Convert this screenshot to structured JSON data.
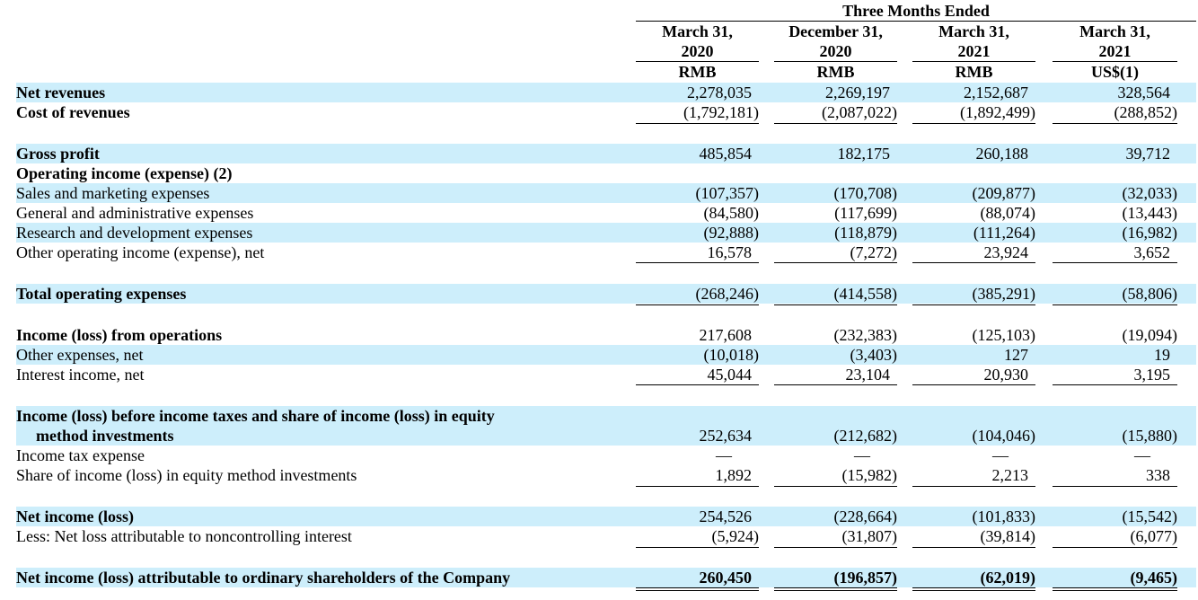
{
  "header": {
    "period_title": "Three Months Ended",
    "columns": [
      {
        "line1": "March 31,",
        "line2": "2020",
        "currency": "RMB"
      },
      {
        "line1": "December 31,",
        "line2": "2020",
        "currency": "RMB"
      },
      {
        "line1": "March 31,",
        "line2": "2021",
        "currency": "RMB"
      },
      {
        "line1": "March 31,",
        "line2": "2021",
        "currency": "US$(1)"
      }
    ]
  },
  "rows": [
    {
      "label": "Net revenues",
      "values": [
        "2,278,035",
        "2,269,197",
        "2,152,687",
        "328,564"
      ]
    },
    {
      "label": "Cost of revenues",
      "values": [
        "(1,792,181)",
        "(2,087,022)",
        "(1,892,499)",
        "(288,852)"
      ]
    },
    {
      "label": "Gross profit",
      "values": [
        "485,854",
        "182,175",
        "260,188",
        "39,712"
      ]
    },
    {
      "label": "Operating income (expense) (2)",
      "values": [
        "",
        "",
        "",
        ""
      ]
    },
    {
      "label": "Sales and marketing expenses",
      "values": [
        "(107,357)",
        "(170,708)",
        "(209,877)",
        "(32,033)"
      ]
    },
    {
      "label": "General and administrative expenses",
      "values": [
        "(84,580)",
        "(117,699)",
        "(88,074)",
        "(13,443)"
      ]
    },
    {
      "label": "Research and development expenses",
      "values": [
        "(92,888)",
        "(118,879)",
        "(111,264)",
        "(16,982)"
      ]
    },
    {
      "label": "Other operating income (expense), net",
      "values": [
        "16,578",
        "(7,272)",
        "23,924",
        "3,652"
      ]
    },
    {
      "label": "Total operating expenses",
      "values": [
        "(268,246)",
        "(414,558)",
        "(385,291)",
        "(58,806)"
      ]
    },
    {
      "label": "Income (loss) from operations",
      "values": [
        "217,608",
        "(232,383)",
        "(125,103)",
        "(19,094)"
      ]
    },
    {
      "label": "Other expenses, net",
      "values": [
        "(10,018)",
        "(3,403)",
        "127",
        "19"
      ]
    },
    {
      "label": "Interest income, net",
      "values": [
        "45,044",
        "23,104",
        "20,930",
        "3,195"
      ]
    },
    {
      "label": "Income (loss) before income taxes and share of income (loss) in equity",
      "label2": "method investments",
      "values": [
        "252,634",
        "(212,682)",
        "(104,046)",
        "(15,880)"
      ]
    },
    {
      "label": "Income tax expense",
      "values": [
        "—",
        "—",
        "—",
        "—"
      ]
    },
    {
      "label": "Share of income (loss) in equity method investments",
      "values": [
        "1,892",
        "(15,982)",
        "2,213",
        "338"
      ]
    },
    {
      "label": "Net income (loss)",
      "values": [
        "254,526",
        "(228,664)",
        "(101,833)",
        "(15,542)"
      ]
    },
    {
      "label": "Less: Net loss attributable to noncontrolling interest",
      "values": [
        "(5,924)",
        "(31,807)",
        "(39,814)",
        "(6,077)"
      ]
    },
    {
      "label": "Net income (loss) attributable to ordinary shareholders of the Company",
      "values": [
        "260,450",
        "(196,857)",
        "(62,019)",
        "(9,465)"
      ]
    }
  ]
}
